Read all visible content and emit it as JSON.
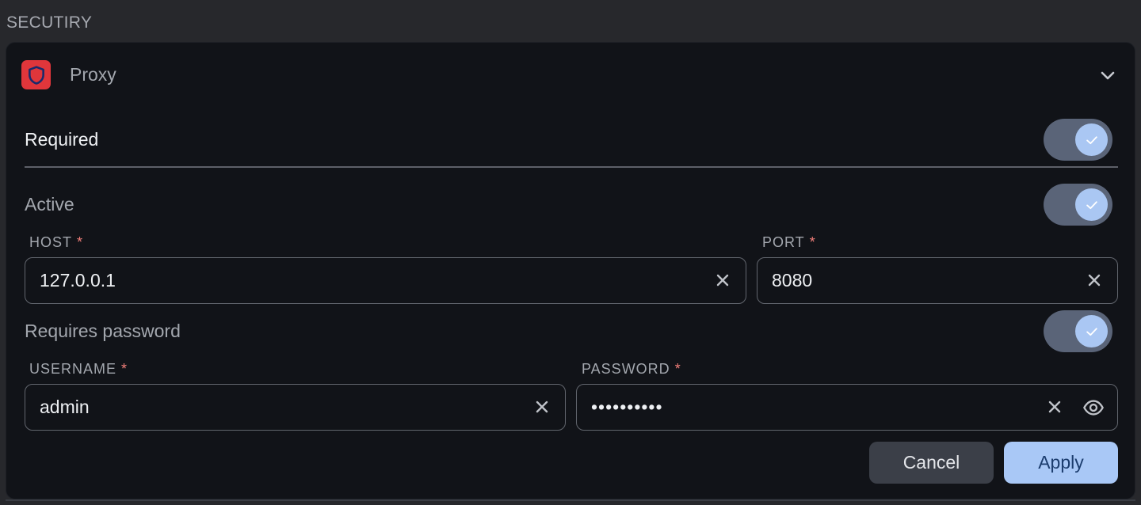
{
  "section": {
    "title": "SECUTIRY"
  },
  "card": {
    "title": "Proxy",
    "app_icon": "shield-icon",
    "toggle_icon": "chevron-down-icon",
    "brand_color": "#e0363b",
    "accent_color": "#a9c8f6"
  },
  "settings": {
    "required_label": "Required",
    "required_on": true,
    "active_label": "Active",
    "active_on": true,
    "requires_password_label": "Requires password",
    "requires_password_on": true
  },
  "fields": {
    "host": {
      "label": "HOST",
      "required_mark": "*",
      "value": "127.0.0.1"
    },
    "port": {
      "label": "PORT",
      "required_mark": "*",
      "value": "8080"
    },
    "username": {
      "label": "USERNAME",
      "required_mark": "*",
      "value": "admin"
    },
    "password": {
      "label": "PASSWORD",
      "required_mark": "*",
      "value": "••••••••••"
    }
  },
  "actions": {
    "cancel_label": "Cancel",
    "apply_label": "Apply"
  }
}
